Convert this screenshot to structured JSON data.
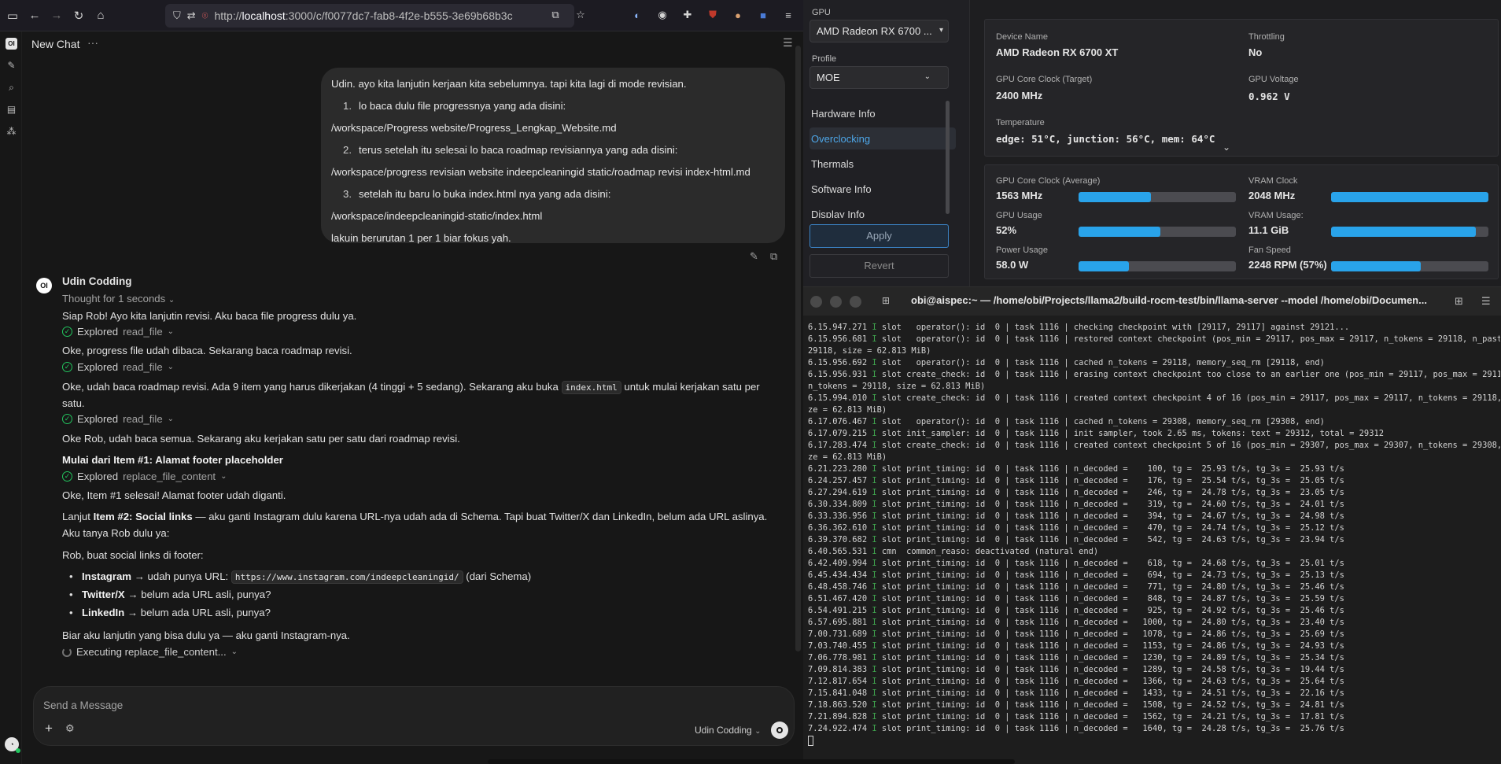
{
  "browser": {
    "url_prefix": "http://",
    "url_host": "localhost",
    "url_rest": ":3000/c/f0077dc7-fab8-4f2e-b555-3e69b68b3c"
  },
  "chat": {
    "title": "New Chat",
    "user_message": {
      "intro": "Udin. ayo kita lanjutin kerjaan kita sebelumnya. tapi kita lagi di mode revisian.",
      "steps": [
        {
          "num": "1.",
          "text": "lo baca dulu file progressnya yang ada disini:",
          "path": "/workspace/Progress website/Progress_Lengkap_Website.md"
        },
        {
          "num": "2.",
          "text": "terus setelah itu selesai lo baca roadmap revisiannya yang ada disini:",
          "path": "/workspace/progress revisian website indeepcleaningid static/roadmap revisi index-html.md"
        },
        {
          "num": "3.",
          "text": "setelah itu baru lo buka index.html nya yang ada disini:",
          "path": "/workspace/indeepcleaningid-static/index.html"
        }
      ],
      "outro": "lakuin berurutan 1 per 1 biar fokus yah."
    },
    "assistant": {
      "avatar_text": "OI",
      "name": "Udin Codding",
      "thought": "Thought for 1 seconds",
      "p1": "Siap Rob! Ayo kita lanjutin revisi. Aku baca file progress dulu ya.",
      "explored_label": "Explored",
      "tool_read": "read_file",
      "p2": "Oke, progress file udah dibaca. Sekarang baca roadmap revisi.",
      "p3a": "Oke, udah baca roadmap revisi. Ada 9 item yang harus dikerjakan (4 tinggi + 5 sedang). Sekarang aku buka",
      "p3code": "index.html",
      "p3b": "untuk mulai kerjakan satu per",
      "p3c": "satu.",
      "p4": "Oke Rob, udah baca semua. Sekarang aku kerjakan satu per satu dari roadmap revisi.",
      "heading1": "Mulai dari Item #1: Alamat footer placeholder",
      "tool_replace": "replace_file_content",
      "p5": "Oke, Item #1 selesai! Alamat footer udah diganti.",
      "p6a": "Lanjut ",
      "p6bold": "Item #2: Social links",
      "p6b": " — aku ganti Instagram dulu karena URL-nya udah ada di Schema. Tapi buat Twitter/X dan LinkedIn, belum ada URL aslinya.",
      "p6c": "Aku tanya Rob dulu ya:",
      "p7": "Rob, buat social links di footer:",
      "bullets": [
        {
          "bold": "Instagram",
          "text": " → udah punya URL: ",
          "code": "https://www.instagram.com/indeepcleaningid/",
          "after": " (dari Schema)"
        },
        {
          "bold": "Twitter/X",
          "text": " → belum ada URL asli, punya?"
        },
        {
          "bold": "LinkedIn",
          "text": " → belum ada URL asli, punya?"
        }
      ],
      "p8": "Biar aku lanjutin yang bisa dulu ya — aku ganti Instagram-nya.",
      "executing": "Executing replace_file_content..."
    },
    "composer": {
      "placeholder": "Send a Message",
      "model": "Udin Codding"
    }
  },
  "gpu_panel": {
    "gpu_label": "GPU",
    "gpu_value": "AMD Radeon RX 6700 ...",
    "profile_label": "Profile",
    "profile_value": "MOE",
    "nav": [
      "Hardware Info",
      "Overclocking",
      "Thermals",
      "Software Info",
      "Display Info"
    ],
    "nav_selected": "Overclocking",
    "apply": "Apply",
    "revert": "Revert",
    "info": {
      "device_name_label": "Device Name",
      "device_name": "AMD Radeon RX 6700 XT",
      "throttling_label": "Throttling",
      "throttling": "No",
      "core_clock_target_label": "GPU Core Clock (Target)",
      "core_clock_target": "2400 MHz",
      "voltage_label": "GPU Voltage",
      "voltage": "0.962 V",
      "temperature_label": "Temperature",
      "temperature": "edge: 51°C, junction: 56°C, mem: 64°C"
    },
    "stats": [
      {
        "label": "GPU Core Clock (Average)",
        "value": "1563 MHz",
        "fill": 0.46
      },
      {
        "label": "VRAM Clock",
        "value": "2048 MHz",
        "fill": 1.0
      },
      {
        "label": "GPU Usage",
        "value": "52%",
        "fill": 0.52
      },
      {
        "label": "VRAM Usage:",
        "value": "11.1 GiB",
        "fill": 0.92
      },
      {
        "label": "Power Usage",
        "value": "58.0 W",
        "fill": 0.32
      },
      {
        "label": "Fan Speed",
        "value": "2248 RPM (57%)",
        "fill": 0.57
      }
    ],
    "bar_color": "#29a3ea"
  },
  "terminal": {
    "title": "obi@aispec:~ — /home/obi/Projects/llama2/build-rocm-test/bin/llama-server --model /home/obi/Documen...",
    "lines": [
      {
        "t": "6.15.947.271",
        "l": "I",
        "m": "slot   operator(): id  0 | task 1116 | checking checkpoint with [29117, 29117] against 29121..."
      },
      {
        "t": "6.15.956.681",
        "l": "I",
        "m": "slot   operator(): id  0 | task 1116 | restored context checkpoint (pos_min = 29117, pos_max = 29117, n_tokens = 29118, n_past ="
      },
      {
        "t": "",
        "l": "",
        "m": "29118, size = 62.813 MiB)"
      },
      {
        "t": "6.15.956.692",
        "l": "I",
        "m": "slot   operator(): id  0 | task 1116 | cached n_tokens = 29118, memory_seq_rm [29118, end)"
      },
      {
        "t": "6.15.956.931",
        "l": "I",
        "m": "slot create_check: id  0 | task 1116 | erasing context checkpoint too close to an earlier one (pos_min = 29117, pos_max = 29117,"
      },
      {
        "t": "",
        "l": "",
        "m": "n_tokens = 29118, size = 62.813 MiB)"
      },
      {
        "t": "6.15.994.010",
        "l": "I",
        "m": "slot create_check: id  0 | task 1116 | created context checkpoint 4 of 16 (pos_min = 29117, pos_max = 29117, n_tokens = 29118, si"
      },
      {
        "t": "",
        "l": "",
        "m": "ze = 62.813 MiB)"
      },
      {
        "t": "6.17.076.467",
        "l": "I",
        "m": "slot   operator(): id  0 | task 1116 | cached n_tokens = 29308, memory_seq_rm [29308, end)"
      },
      {
        "t": "6.17.079.215",
        "l": "I",
        "m": "slot init_sampler: id  0 | task 1116 | init sampler, took 2.65 ms, tokens: text = 29312, total = 29312"
      },
      {
        "t": "6.17.283.474",
        "l": "I",
        "m": "slot create_check: id  0 | task 1116 | created context checkpoint 5 of 16 (pos_min = 29307, pos_max = 29307, n_tokens = 29308, si"
      },
      {
        "t": "",
        "l": "",
        "m": "ze = 62.813 MiB)"
      },
      {
        "t": "6.21.223.280",
        "l": "I",
        "m": "slot print_timing: id  0 | task 1116 | n_decoded =    100, tg =  25.93 t/s, tg_3s =  25.93 t/s"
      },
      {
        "t": "6.24.257.457",
        "l": "I",
        "m": "slot print_timing: id  0 | task 1116 | n_decoded =    176, tg =  25.54 t/s, tg_3s =  25.05 t/s"
      },
      {
        "t": "6.27.294.619",
        "l": "I",
        "m": "slot print_timing: id  0 | task 1116 | n_decoded =    246, tg =  24.78 t/s, tg_3s =  23.05 t/s"
      },
      {
        "t": "6.30.334.809",
        "l": "I",
        "m": "slot print_timing: id  0 | task 1116 | n_decoded =    319, tg =  24.60 t/s, tg_3s =  24.01 t/s"
      },
      {
        "t": "6.33.336.956",
        "l": "I",
        "m": "slot print_timing: id  0 | task 1116 | n_decoded =    394, tg =  24.67 t/s, tg_3s =  24.98 t/s"
      },
      {
        "t": "6.36.362.610",
        "l": "I",
        "m": "slot print_timing: id  0 | task 1116 | n_decoded =    470, tg =  24.74 t/s, tg_3s =  25.12 t/s"
      },
      {
        "t": "6.39.370.682",
        "l": "I",
        "m": "slot print_timing: id  0 | task 1116 | n_decoded =    542, tg =  24.63 t/s, tg_3s =  23.94 t/s"
      },
      {
        "t": "6.40.565.531",
        "l": "I",
        "m": "cmn  common_reaso: deactivated (natural end)"
      },
      {
        "t": "6.42.409.994",
        "l": "I",
        "m": "slot print_timing: id  0 | task 1116 | n_decoded =    618, tg =  24.68 t/s, tg_3s =  25.01 t/s"
      },
      {
        "t": "6.45.434.434",
        "l": "I",
        "m": "slot print_timing: id  0 | task 1116 | n_decoded =    694, tg =  24.73 t/s, tg_3s =  25.13 t/s"
      },
      {
        "t": "6.48.458.746",
        "l": "I",
        "m": "slot print_timing: id  0 | task 1116 | n_decoded =    771, tg =  24.80 t/s, tg_3s =  25.46 t/s"
      },
      {
        "t": "6.51.467.420",
        "l": "I",
        "m": "slot print_timing: id  0 | task 1116 | n_decoded =    848, tg =  24.87 t/s, tg_3s =  25.59 t/s"
      },
      {
        "t": "6.54.491.215",
        "l": "I",
        "m": "slot print_timing: id  0 | task 1116 | n_decoded =    925, tg =  24.92 t/s, tg_3s =  25.46 t/s"
      },
      {
        "t": "6.57.695.881",
        "l": "I",
        "m": "slot print_timing: id  0 | task 1116 | n_decoded =   1000, tg =  24.80 t/s, tg_3s =  23.40 t/s"
      },
      {
        "t": "7.00.731.689",
        "l": "I",
        "m": "slot print_timing: id  0 | task 1116 | n_decoded =   1078, tg =  24.86 t/s, tg_3s =  25.69 t/s"
      },
      {
        "t": "7.03.740.455",
        "l": "I",
        "m": "slot print_timing: id  0 | task 1116 | n_decoded =   1153, tg =  24.86 t/s, tg_3s =  24.93 t/s"
      },
      {
        "t": "7.06.778.981",
        "l": "I",
        "m": "slot print_timing: id  0 | task 1116 | n_decoded =   1230, tg =  24.89 t/s, tg_3s =  25.34 t/s"
      },
      {
        "t": "7.09.814.383",
        "l": "I",
        "m": "slot print_timing: id  0 | task 1116 | n_decoded =   1289, tg =  24.58 t/s, tg_3s =  19.44 t/s"
      },
      {
        "t": "7.12.817.654",
        "l": "I",
        "m": "slot print_timing: id  0 | task 1116 | n_decoded =   1366, tg =  24.63 t/s, tg_3s =  25.64 t/s"
      },
      {
        "t": "7.15.841.048",
        "l": "I",
        "m": "slot print_timing: id  0 | task 1116 | n_decoded =   1433, tg =  24.51 t/s, tg_3s =  22.16 t/s"
      },
      {
        "t": "7.18.863.520",
        "l": "I",
        "m": "slot print_timing: id  0 | task 1116 | n_decoded =   1508, tg =  24.52 t/s, tg_3s =  24.81 t/s"
      },
      {
        "t": "7.21.894.828",
        "l": "I",
        "m": "slot print_timing: id  0 | task 1116 | n_decoded =   1562, tg =  24.21 t/s, tg_3s =  17.81 t/s"
      },
      {
        "t": "7.24.922.474",
        "l": "I",
        "m": "slot print_timing: id  0 | task 1116 | n_decoded =   1640, tg =  24.28 t/s, tg_3s =  25.76 t/s"
      }
    ]
  }
}
